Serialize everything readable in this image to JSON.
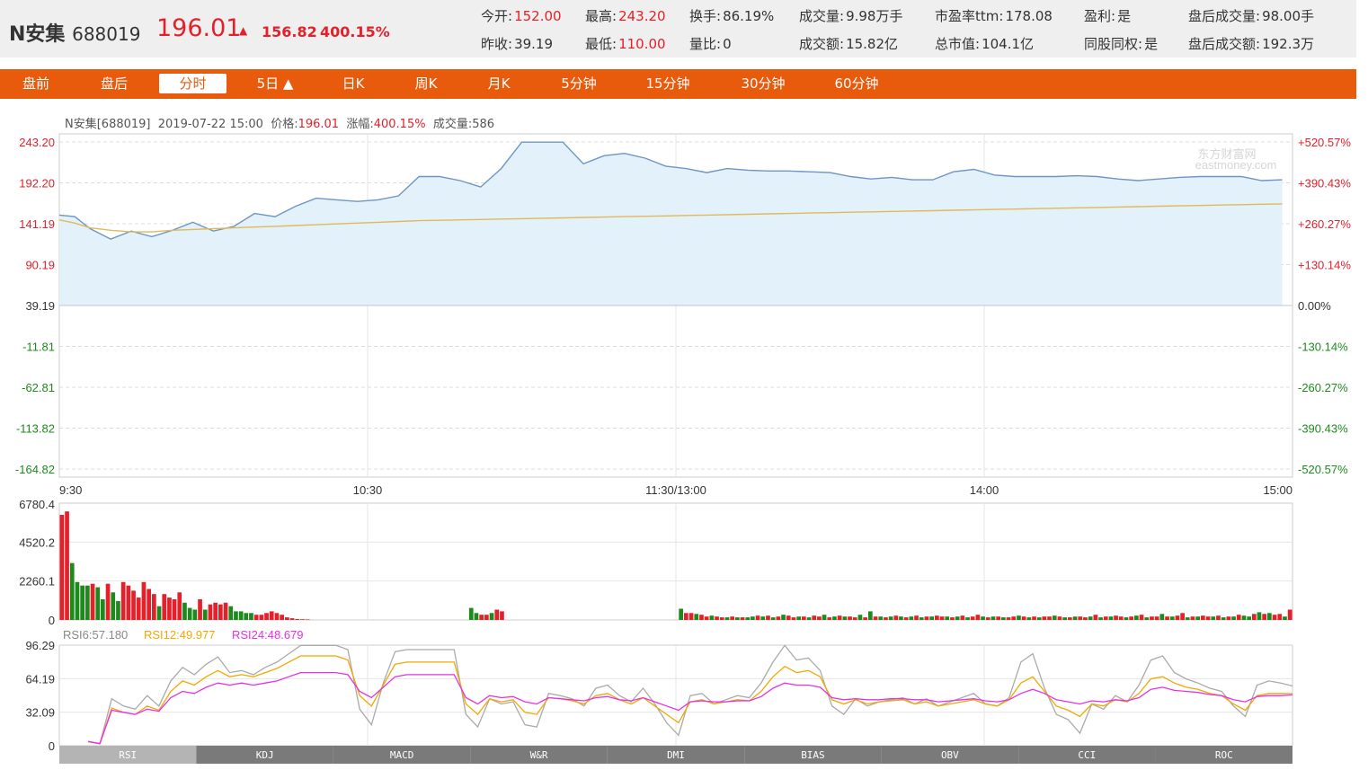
{
  "stock": {
    "name": "N安集",
    "code": "688019",
    "price": "196.01",
    "arrow": "▲",
    "change": "156.82",
    "change_pct": "400.15%"
  },
  "stats": [
    {
      "label": "今开:",
      "value": "152.00",
      "red": true
    },
    {
      "label": "最高:",
      "value": "243.20",
      "red": true
    },
    {
      "label": "换手:",
      "value": "86.19%",
      "red": false
    },
    {
      "label": "成交量:",
      "value": "9.98万手",
      "red": false
    },
    {
      "label": "市盈率ttm:",
      "value": "178.08",
      "red": false
    },
    {
      "label": "盈利:",
      "value": "是",
      "red": false
    },
    {
      "label": "盘后成交量:",
      "value": "98.00手",
      "red": false
    },
    {
      "label": "昨收:",
      "value": "39.19",
      "red": false
    },
    {
      "label": "最低:",
      "value": "110.00",
      "red": true
    },
    {
      "label": "量比:",
      "value": "0",
      "red": false
    },
    {
      "label": "成交额:",
      "value": "15.82亿",
      "red": false
    },
    {
      "label": "总市值:",
      "value": "104.1亿",
      "red": false
    },
    {
      "label": "同股同权:",
      "value": "是",
      "red": false
    },
    {
      "label": "盘后成交额:",
      "value": "192.3万",
      "red": false
    }
  ],
  "tabs": [
    "盘前",
    "盘后",
    "分时",
    "5日 ▲",
    "日K",
    "周K",
    "月K",
    "5分钟",
    "15分钟",
    "30分钟",
    "60分钟"
  ],
  "active_tab": "分时",
  "chart_header": {
    "name_code": "N安集[688019]",
    "datetime": "2019-07-22 15:00",
    "price_label": "价格:",
    "price": "196.01",
    "change_label": "涨幅:",
    "change": "400.15%",
    "volume_label": "成交量:",
    "volume": "586"
  },
  "watermark": {
    "cn": "东方财富网",
    "en": "eastmoney.com"
  },
  "colors": {
    "up": "#e4202a",
    "down": "#1e8a1e",
    "price_line": "#6d96c4",
    "price_fill": "#e3f1fb",
    "avg_line": "#e0b95a",
    "tab_bar": "#e85a0c",
    "rsi6": "#aaaaaa",
    "rsi12": "#f2a800",
    "rsi24": "#e632e6"
  },
  "indicator_tabs": [
    "RSI",
    "KDJ",
    "MACD",
    "W&R",
    "DMI",
    "BIAS",
    "OBV",
    "CCI",
    "ROC"
  ],
  "active_indicator": "RSI",
  "rsi_labels": [
    {
      "text": "RSI6:57.180",
      "color": "#888888"
    },
    {
      "text": "RSI12:49.977",
      "color": "#f2a800"
    },
    {
      "text": "RSI24:48.679",
      "color": "#e632e6"
    }
  ],
  "chart_data": [
    {
      "type": "line",
      "title": "N安集 分时",
      "x_ticks": [
        "9:30",
        "10:30",
        "11:30/13:00",
        "14:00",
        "15:00"
      ],
      "y_ticks": [
        "243.20",
        "192.20",
        "141.19",
        "90.19",
        "39.19",
        "-11.81",
        "-62.81",
        "-113.82",
        "-164.82"
      ],
      "y_ticks_right": [
        "+520.57%",
        "+390.43%",
        "+260.27%",
        "+130.14%",
        "0.00%",
        "-130.14%",
        "-260.27%",
        "-390.43%",
        "-520.57%"
      ],
      "ylim": [
        -164.82,
        243.2
      ],
      "prev_close": 39.19,
      "x_minutes": [
        0,
        3,
        6,
        10,
        14,
        18,
        22,
        26,
        30,
        34,
        38,
        42,
        46,
        50,
        54,
        58,
        62,
        66,
        70,
        74,
        78,
        82,
        86,
        90,
        94,
        98,
        102,
        106,
        110,
        114,
        118,
        122,
        126,
        130,
        134,
        138,
        142,
        146,
        150,
        154,
        158,
        162,
        166,
        170,
        174,
        178,
        182,
        186,
        190,
        194,
        198,
        202,
        206,
        210,
        214,
        218,
        222,
        226,
        230,
        234,
        238
      ],
      "series": [
        {
          "name": "价格",
          "values": [
            152,
            150,
            135,
            122,
            132,
            125,
            133,
            143,
            132,
            138,
            154,
            150,
            163,
            173,
            171,
            169,
            171,
            176,
            200,
            200,
            195,
            187,
            210,
            243,
            243,
            243,
            216,
            226,
            229,
            223,
            213,
            210,
            205,
            210,
            208,
            207,
            207,
            206,
            205,
            200,
            197,
            199,
            196,
            196,
            206,
            209,
            202,
            200,
            200,
            200,
            201,
            200,
            197,
            195,
            197,
            199,
            200,
            200,
            200,
            195,
            196.01
          ]
        },
        {
          "name": "均价",
          "values": [
            146,
            142,
            136,
            133,
            131,
            131,
            133,
            134,
            135,
            136,
            137,
            138,
            139,
            140,
            141,
            142,
            143,
            144,
            145,
            145.5,
            146,
            146.5,
            147,
            147.5,
            148,
            148.5,
            149,
            149.5,
            150,
            150.5,
            151,
            151.5,
            152,
            152.5,
            153,
            153.5,
            154,
            154.5,
            155,
            155.5,
            156,
            156.5,
            157,
            157.5,
            158,
            158.5,
            159,
            159.5,
            160,
            160.5,
            161,
            161.5,
            162,
            162.5,
            163,
            163.5,
            164,
            164.5,
            165,
            165.5,
            166
          ]
        }
      ]
    },
    {
      "type": "bar",
      "title": "成交量",
      "y_ticks": [
        "6780.4",
        "4520.2",
        "2260.1",
        "0"
      ],
      "ylim": [
        0,
        6780.4
      ],
      "values": [
        6100,
        6300,
        3300,
        2200,
        2000,
        2000,
        2100,
        1900,
        1200,
        2100,
        1600,
        1100,
        2200,
        2000,
        1700,
        1300,
        2200,
        1800,
        1500,
        800,
        1500,
        1300,
        1200,
        1600,
        1000,
        700,
        600,
        1200,
        600,
        900,
        1000,
        900,
        1000,
        800,
        500,
        500,
        400,
        400,
        300,
        300,
        400,
        500,
        400,
        300,
        150,
        100,
        50,
        40,
        30,
        0,
        0,
        0,
        0,
        0,
        0,
        0,
        0,
        0,
        0,
        0,
        0,
        0,
        0,
        0,
        0,
        0,
        0,
        0,
        0,
        0,
        0,
        0,
        0,
        0,
        0,
        0,
        0,
        0,
        0,
        0,
        700,
        400,
        300,
        300,
        400,
        600,
        500,
        0,
        0,
        0,
        0,
        0,
        0,
        0,
        0,
        0,
        0,
        0,
        0,
        0,
        0,
        0,
        0,
        0,
        0,
        0,
        0,
        0,
        0,
        0,
        0,
        0,
        0,
        0,
        0,
        0,
        0,
        0,
        0,
        0,
        0,
        650,
        400,
        400,
        350,
        300,
        200,
        250,
        200,
        150,
        150,
        200,
        150,
        150,
        150,
        200,
        250,
        200,
        250,
        150,
        200,
        300,
        250,
        150,
        200,
        200,
        150,
        250,
        200,
        300,
        150,
        200,
        250,
        200,
        200,
        150,
        300,
        150,
        500,
        200,
        200,
        150,
        200,
        250,
        200,
        150,
        200,
        250,
        150,
        200,
        200,
        250,
        200,
        200,
        150,
        200,
        250,
        150,
        200,
        300,
        200,
        150,
        200,
        200,
        150,
        150,
        200,
        250,
        200,
        150,
        200,
        150,
        200,
        200,
        250,
        200,
        150,
        150,
        200,
        200,
        150,
        200,
        300,
        150,
        200,
        200,
        250,
        200,
        150,
        200,
        250,
        300,
        150,
        200,
        200,
        350,
        200,
        200,
        250,
        400,
        150,
        200,
        200,
        250,
        200,
        200,
        250,
        150,
        200,
        200,
        300,
        250,
        200,
        350,
        450,
        350,
        400,
        300,
        350,
        200,
        600
      ],
      "colors": [
        "up",
        "up",
        "down",
        "down",
        "down",
        "down",
        "up",
        "down",
        "down",
        "up",
        "down",
        "down",
        "up",
        "up",
        "up",
        "up",
        "up",
        "up",
        "up",
        "down",
        "up",
        "up",
        "up",
        "up",
        "down",
        "down",
        "down",
        "up",
        "down",
        "up",
        "up",
        "up",
        "up",
        "down",
        "down",
        "down",
        "down",
        "down",
        "up",
        "up",
        "up",
        "up",
        "up",
        "up",
        "up",
        "up",
        "up",
        "up",
        "up",
        "up",
        "up",
        "up",
        "up",
        "up",
        "up",
        "up",
        "up",
        "up",
        "up",
        "up",
        "up",
        "up",
        "up",
        "up",
        "up",
        "up",
        "up",
        "up",
        "up",
        "up",
        "up",
        "up",
        "up",
        "up",
        "up",
        "up",
        "up",
        "up",
        "up",
        "up",
        "down",
        "down",
        "up",
        "up",
        "down",
        "up",
        "up",
        "up",
        "up",
        "up",
        "up",
        "up",
        "up",
        "up",
        "up",
        "up",
        "up",
        "up",
        "up",
        "up",
        "up",
        "up",
        "up",
        "up",
        "up",
        "up",
        "up",
        "up",
        "up",
        "up",
        "up",
        "up",
        "up",
        "up",
        "up",
        "up",
        "up",
        "up",
        "up",
        "up",
        "up",
        "down",
        "up",
        "up",
        "down",
        "up",
        "up",
        "down",
        "up",
        "up",
        "down",
        "up",
        "down",
        "up",
        "down",
        "down",
        "up",
        "down",
        "up",
        "down",
        "up",
        "down",
        "up",
        "up",
        "down",
        "up",
        "down",
        "up",
        "up",
        "down",
        "up",
        "down",
        "up",
        "down",
        "up",
        "up",
        "down",
        "up",
        "down",
        "up",
        "down",
        "up",
        "down",
        "up",
        "down",
        "up",
        "down",
        "up",
        "down",
        "up",
        "down",
        "up",
        "up",
        "down",
        "up",
        "down",
        "up",
        "down",
        "up",
        "up",
        "down",
        "up",
        "down",
        "up",
        "down",
        "up",
        "up",
        "down",
        "up",
        "down",
        "up",
        "down",
        "up",
        "up",
        "down",
        "up",
        "down",
        "up",
        "down",
        "up",
        "up",
        "down",
        "up",
        "down",
        "up",
        "down",
        "up",
        "up",
        "down",
        "up",
        "down",
        "up",
        "down",
        "up",
        "up",
        "down",
        "up",
        "down",
        "up",
        "up",
        "down",
        "up",
        "down",
        "up",
        "up",
        "down",
        "up",
        "down",
        "up",
        "down",
        "up",
        "down",
        "down",
        "up",
        "down",
        "up",
        "down",
        "up",
        "up",
        "down",
        "up",
        "down",
        "up",
        "up",
        "down"
      ]
    },
    {
      "type": "line",
      "title": "RSI",
      "y_ticks": [
        "96.29",
        "64.19",
        "32.09",
        "0"
      ],
      "ylim": [
        0,
        96.29
      ],
      "series": [
        {
          "name": "RSI6",
          "values": [
            4,
            2,
            45,
            38,
            35,
            48,
            38,
            62,
            75,
            68,
            78,
            85,
            70,
            72,
            68,
            75,
            80,
            88,
            96,
            96,
            96,
            96,
            92,
            35,
            20,
            60,
            90,
            92,
            92,
            92,
            92,
            92,
            30,
            18,
            45,
            40,
            42,
            20,
            18,
            50,
            48,
            45,
            38,
            55,
            58,
            48,
            42,
            55,
            40,
            22,
            10,
            48,
            50,
            40,
            44,
            48,
            46,
            60,
            80,
            96,
            82,
            84,
            72,
            38,
            30,
            45,
            38,
            42,
            44,
            46,
            40,
            45,
            38,
            42,
            46,
            50,
            40,
            38,
            46,
            80,
            88,
            55,
            30,
            25,
            12,
            40,
            35,
            48,
            42,
            58,
            82,
            86,
            70,
            64,
            60,
            55,
            52,
            38,
            28,
            58,
            62,
            60,
            57.18
          ]
        },
        {
          "name": "RSI12",
          "values": [
            4,
            2,
            36,
            32,
            30,
            38,
            34,
            52,
            62,
            58,
            66,
            72,
            66,
            68,
            66,
            70,
            74,
            80,
            86,
            86,
            86,
            86,
            82,
            48,
            38,
            58,
            78,
            80,
            80,
            80,
            80,
            80,
            40,
            30,
            45,
            42,
            44,
            32,
            30,
            46,
            45,
            43,
            40,
            48,
            50,
            44,
            40,
            46,
            38,
            30,
            22,
            42,
            44,
            40,
            42,
            44,
            43,
            52,
            66,
            76,
            70,
            72,
            66,
            44,
            40,
            44,
            40,
            42,
            43,
            44,
            40,
            42,
            38,
            40,
            42,
            44,
            40,
            38,
            44,
            60,
            66,
            52,
            38,
            34,
            28,
            40,
            38,
            44,
            42,
            50,
            64,
            66,
            60,
            56,
            54,
            50,
            48,
            40,
            34,
            48,
            50,
            50,
            49.977
          ]
        },
        {
          "name": "RSI24",
          "values": [
            4,
            2,
            34,
            32,
            30,
            35,
            33,
            46,
            52,
            50,
            56,
            60,
            58,
            60,
            58,
            60,
            62,
            66,
            70,
            70,
            70,
            70,
            68,
            52,
            46,
            56,
            66,
            68,
            68,
            68,
            68,
            68,
            46,
            40,
            48,
            46,
            47,
            42,
            40,
            46,
            45,
            44,
            43,
            46,
            47,
            44,
            43,
            46,
            42,
            38,
            34,
            42,
            43,
            42,
            42,
            43,
            43,
            47,
            55,
            60,
            58,
            58,
            56,
            46,
            44,
            45,
            44,
            44,
            45,
            45,
            44,
            44,
            42,
            43,
            44,
            45,
            43,
            42,
            44,
            50,
            54,
            50,
            44,
            42,
            40,
            43,
            42,
            44,
            43,
            46,
            54,
            56,
            53,
            52,
            51,
            49,
            48,
            44,
            42,
            47,
            48,
            48,
            48.679
          ]
        }
      ]
    }
  ]
}
